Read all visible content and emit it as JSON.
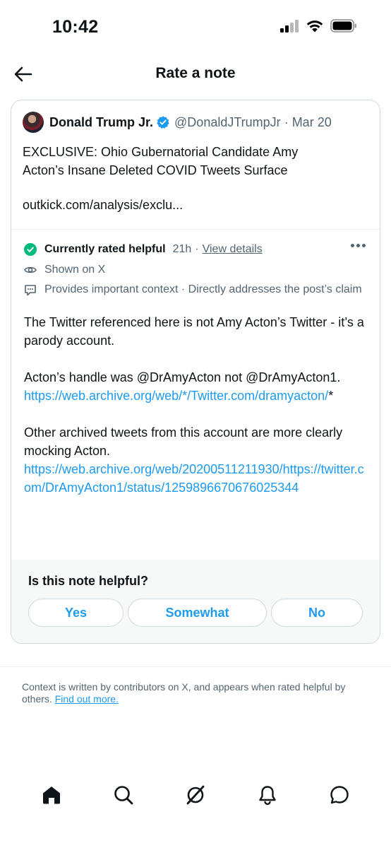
{
  "status_bar": {
    "time": "10:42"
  },
  "header": {
    "title": "Rate a note"
  },
  "post": {
    "author": "Donald Trump Jr.",
    "handle": "@DonaldJTrumpJr",
    "date": "Mar 20",
    "text": "EXCLUSIVE: Ohio Gubernatorial Candidate Amy Acton’s Insane Deleted COVID Tweets Surface",
    "link": "outkick.com/analysis/exclu..."
  },
  "note": {
    "status": "Currently rated helpful",
    "age": "21h",
    "view_details": "View details",
    "shown_on": "Shown on X",
    "reasons": "Provides important context · Directly addresses the post’s claim",
    "para1": "The Twitter referenced here  is not Amy Acton’s Twitter - it’s a parody account.",
    "para2_text": "Acton’s handle was @DrAmyActon not @DrAmyActon1.",
    "para2_link": "https://web.archive.org/web/*/Twitter.com/dramyacton/",
    "para2_suffix": "*",
    "para3_text": "Other archived tweets from this account are more clearly mocking Acton.",
    "para3_link": "https://web.archive.org/web/20200511211930/https://twitter.com/DrAmyActon1/status/1259896670676025344"
  },
  "rating": {
    "question": "Is this note helpful?",
    "yes": "Yes",
    "somewhat": "Somewhat",
    "no": "No"
  },
  "footer": {
    "text": "Context is written by contributors on X, and appears when rated helpful by others.",
    "link": "Find out more."
  },
  "tabs": [
    "home-icon",
    "search-icon",
    "grok-icon",
    "notifications-icon",
    "messages-icon"
  ],
  "colors": {
    "accent": "#1d9bf0",
    "helpful_green": "#00ba7c",
    "muted": "#536471"
  }
}
